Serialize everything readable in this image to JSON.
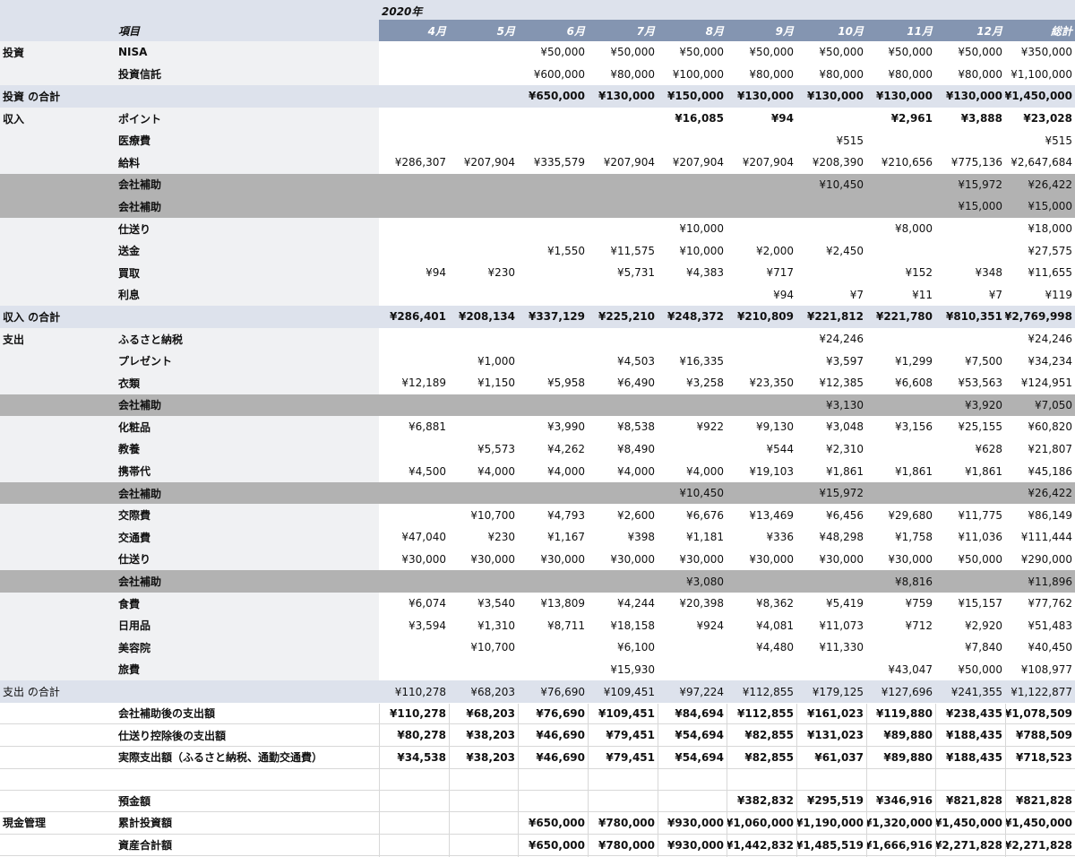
{
  "year": "2020年",
  "columns": {
    "item": "項目",
    "months": [
      "4月",
      "5月",
      "6月",
      "7月",
      "8月",
      "9月",
      "10月",
      "11月",
      "12月",
      "総計"
    ]
  },
  "rows": [
    {
      "type": "detail",
      "cat": "投資",
      "item": "NISA",
      "values": [
        "",
        "",
        "¥50,000",
        "¥50,000",
        "¥50,000",
        "¥50,000",
        "¥50,000",
        "¥50,000",
        "¥50,000",
        "¥350,000"
      ]
    },
    {
      "type": "detail",
      "cat": "",
      "item": "投資信託",
      "values": [
        "",
        "",
        "¥600,000",
        "¥80,000",
        "¥100,000",
        "¥80,000",
        "¥80,000",
        "¥80,000",
        "¥80,000",
        "¥1,100,000"
      ]
    },
    {
      "type": "total",
      "cat": "投資 の合計",
      "item": "",
      "values": [
        "",
        "",
        "¥650,000",
        "¥130,000",
        "¥150,000",
        "¥130,000",
        "¥130,000",
        "¥130,000",
        "¥130,000",
        "¥1,450,000"
      ]
    },
    {
      "type": "detail",
      "cat": "収入",
      "item": "ポイント",
      "bold": true,
      "values": [
        "",
        "",
        "",
        "",
        "¥16,085",
        "¥94",
        "",
        "¥2,961",
        "¥3,888",
        "¥23,028"
      ]
    },
    {
      "type": "detail",
      "cat": "",
      "item": "医療費",
      "values": [
        "",
        "",
        "",
        "",
        "",
        "",
        "¥515",
        "",
        "",
        "¥515"
      ]
    },
    {
      "type": "detail",
      "cat": "",
      "item": "給料",
      "values": [
        "¥286,307",
        "¥207,904",
        "¥335,579",
        "¥207,904",
        "¥207,904",
        "¥207,904",
        "¥208,390",
        "¥210,656",
        "¥775,136",
        "¥2,647,684"
      ]
    },
    {
      "type": "sub",
      "cat": "",
      "item": "会社補助",
      "values": [
        "",
        "",
        "",
        "",
        "",
        "",
        "¥10,450",
        "",
        "¥15,972",
        "¥26,422"
      ]
    },
    {
      "type": "sub",
      "cat": "",
      "item": "会社補助",
      "values": [
        "",
        "",
        "",
        "",
        "",
        "",
        "",
        "",
        "¥15,000",
        "¥15,000"
      ]
    },
    {
      "type": "detail",
      "cat": "",
      "item": "仕送り",
      "values": [
        "",
        "",
        "",
        "",
        "¥10,000",
        "",
        "",
        "¥8,000",
        "",
        "¥18,000"
      ]
    },
    {
      "type": "detail",
      "cat": "",
      "item": "送金",
      "values": [
        "",
        "",
        "¥1,550",
        "¥11,575",
        "¥10,000",
        "¥2,000",
        "¥2,450",
        "",
        "",
        "¥27,575"
      ]
    },
    {
      "type": "detail",
      "cat": "",
      "item": "買取",
      "values": [
        "¥94",
        "¥230",
        "",
        "¥5,731",
        "¥4,383",
        "¥717",
        "",
        "¥152",
        "¥348",
        "¥11,655"
      ]
    },
    {
      "type": "detail",
      "cat": "",
      "item": "利息",
      "values": [
        "",
        "",
        "",
        "",
        "",
        "¥94",
        "¥7",
        "¥11",
        "¥7",
        "¥119"
      ]
    },
    {
      "type": "total",
      "cat": "収入 の合計",
      "item": "",
      "values": [
        "¥286,401",
        "¥208,134",
        "¥337,129",
        "¥225,210",
        "¥248,372",
        "¥210,809",
        "¥221,812",
        "¥221,780",
        "¥810,351",
        "¥2,769,998"
      ]
    },
    {
      "type": "detail",
      "cat": "支出",
      "item": "ふるさと納税",
      "values": [
        "",
        "",
        "",
        "",
        "",
        "",
        "¥24,246",
        "",
        "",
        "¥24,246"
      ]
    },
    {
      "type": "detail",
      "cat": "",
      "item": "プレゼント",
      "values": [
        "",
        "¥1,000",
        "",
        "¥4,503",
        "¥16,335",
        "",
        "¥3,597",
        "¥1,299",
        "¥7,500",
        "¥34,234"
      ]
    },
    {
      "type": "detail",
      "cat": "",
      "item": "衣類",
      "values": [
        "¥12,189",
        "¥1,150",
        "¥5,958",
        "¥6,490",
        "¥3,258",
        "¥23,350",
        "¥12,385",
        "¥6,608",
        "¥53,563",
        "¥124,951"
      ]
    },
    {
      "type": "sub",
      "cat": "",
      "item": "会社補助",
      "values": [
        "",
        "",
        "",
        "",
        "",
        "",
        "¥3,130",
        "",
        "¥3,920",
        "¥7,050"
      ]
    },
    {
      "type": "detail",
      "cat": "",
      "item": "化粧品",
      "values": [
        "¥6,881",
        "",
        "¥3,990",
        "¥8,538",
        "¥922",
        "¥9,130",
        "¥3,048",
        "¥3,156",
        "¥25,155",
        "¥60,820"
      ]
    },
    {
      "type": "detail",
      "cat": "",
      "item": "教養",
      "values": [
        "",
        "¥5,573",
        "¥4,262",
        "¥8,490",
        "",
        "¥544",
        "¥2,310",
        "",
        "¥628",
        "¥21,807"
      ]
    },
    {
      "type": "detail",
      "cat": "",
      "item": "携帯代",
      "values": [
        "¥4,500",
        "¥4,000",
        "¥4,000",
        "¥4,000",
        "¥4,000",
        "¥19,103",
        "¥1,861",
        "¥1,861",
        "¥1,861",
        "¥45,186"
      ]
    },
    {
      "type": "sub",
      "cat": "",
      "item": "会社補助",
      "values": [
        "",
        "",
        "",
        "",
        "¥10,450",
        "",
        "¥15,972",
        "",
        "",
        "¥26,422"
      ]
    },
    {
      "type": "detail",
      "cat": "",
      "item": "交際費",
      "values": [
        "",
        "¥10,700",
        "¥4,793",
        "¥2,600",
        "¥6,676",
        "¥13,469",
        "¥6,456",
        "¥29,680",
        "¥11,775",
        "¥86,149"
      ]
    },
    {
      "type": "detail",
      "cat": "",
      "item": "交通費",
      "values": [
        "¥47,040",
        "¥230",
        "¥1,167",
        "¥398",
        "¥1,181",
        "¥336",
        "¥48,298",
        "¥1,758",
        "¥11,036",
        "¥111,444"
      ]
    },
    {
      "type": "detail",
      "cat": "",
      "item": "仕送り",
      "values": [
        "¥30,000",
        "¥30,000",
        "¥30,000",
        "¥30,000",
        "¥30,000",
        "¥30,000",
        "¥30,000",
        "¥30,000",
        "¥50,000",
        "¥290,000"
      ]
    },
    {
      "type": "sub",
      "cat": "",
      "item": "会社補助",
      "values": [
        "",
        "",
        "",
        "",
        "¥3,080",
        "",
        "",
        "¥8,816",
        "",
        "¥11,896"
      ]
    },
    {
      "type": "detail",
      "cat": "",
      "item": "食費",
      "values": [
        "¥6,074",
        "¥3,540",
        "¥13,809",
        "¥4,244",
        "¥20,398",
        "¥8,362",
        "¥5,419",
        "¥759",
        "¥15,157",
        "¥77,762"
      ]
    },
    {
      "type": "detail",
      "cat": "",
      "item": "日用品",
      "values": [
        "¥3,594",
        "¥1,310",
        "¥8,711",
        "¥18,158",
        "¥924",
        "¥4,081",
        "¥11,073",
        "¥712",
        "¥2,920",
        "¥51,483"
      ]
    },
    {
      "type": "detail",
      "cat": "",
      "item": "美容院",
      "values": [
        "",
        "¥10,700",
        "",
        "¥6,100",
        "",
        "¥4,480",
        "¥11,330",
        "",
        "¥7,840",
        "¥40,450"
      ]
    },
    {
      "type": "detail",
      "cat": "",
      "item": "旅費",
      "values": [
        "",
        "",
        "",
        "¥15,930",
        "",
        "",
        "",
        "¥43,047",
        "¥50,000",
        "¥108,977"
      ]
    },
    {
      "type": "total-plain",
      "cat": "支出 の合計",
      "item": "",
      "values": [
        "¥110,278",
        "¥68,203",
        "¥76,690",
        "¥109,451",
        "¥97,224",
        "¥112,855",
        "¥179,125",
        "¥127,696",
        "¥241,355",
        "¥1,122,877"
      ]
    }
  ],
  "summary": [
    {
      "item": "会社補助後の支出額",
      "values": [
        "¥110,278",
        "¥68,203",
        "¥76,690",
        "¥109,451",
        "¥84,694",
        "¥112,855",
        "¥161,023",
        "¥119,880",
        "¥238,435",
        "¥1,078,509"
      ]
    },
    {
      "item": "仕送り控除後の支出額",
      "values": [
        "¥80,278",
        "¥38,203",
        "¥46,690",
        "¥79,451",
        "¥54,694",
        "¥82,855",
        "¥131,023",
        "¥89,880",
        "¥188,435",
        "¥788,509"
      ]
    },
    {
      "item": "実際支出額（ふるさと納税、通勤交通費）",
      "values": [
        "¥34,538",
        "¥38,203",
        "¥46,690",
        "¥79,451",
        "¥54,694",
        "¥82,855",
        "¥61,037",
        "¥89,880",
        "¥188,435",
        "¥718,523"
      ]
    }
  ],
  "cash": {
    "label": "現金管理",
    "rows": [
      {
        "item": "預金額",
        "values": [
          "",
          "",
          "",
          "",
          "",
          "¥382,832",
          "¥295,519",
          "¥346,916",
          "¥821,828",
          "¥821,828"
        ]
      },
      {
        "item": "累計投資額",
        "values": [
          "",
          "",
          "¥650,000",
          "¥780,000",
          "¥930,000",
          "¥1,060,000",
          "¥1,190,000",
          "¥1,320,000",
          "¥1,450,000",
          "¥1,450,000"
        ]
      },
      {
        "item": "資産合計額",
        "values": [
          "",
          "",
          "¥650,000",
          "¥780,000",
          "¥930,000",
          "¥1,442,832",
          "¥1,485,519",
          "¥1,666,916",
          "¥2,271,828",
          "¥2,271,828"
        ]
      }
    ]
  },
  "colors": {
    "header_band": "#dde2ec",
    "month_header": "#8495b1",
    "subsidy_row": "#b2b2b2",
    "label_band": "#f0f1f3"
  }
}
